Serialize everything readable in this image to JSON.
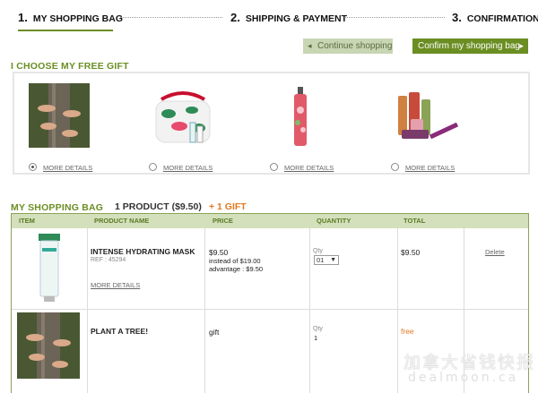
{
  "steps": [
    {
      "num": "1.",
      "label": "MY SHOPPING BAG"
    },
    {
      "num": "2.",
      "label": "SHIPPING & PAYMENT"
    },
    {
      "num": "3.",
      "label": "CONFIRMATION"
    }
  ],
  "actions": {
    "continue_label": "Continue shopping",
    "confirm_label": "Confirm my shopping bag"
  },
  "gift_section": {
    "title": "I CHOOSE MY FREE GIFT",
    "gifts": [
      {
        "image": "tree-hug-photo",
        "more": "MORE DETAILS",
        "selected": true
      },
      {
        "image": "floral-cosmetic-pouch",
        "more": "MORE DETAILS",
        "selected": false
      },
      {
        "image": "body-mist-spray",
        "more": "MORE DETAILS",
        "selected": false
      },
      {
        "image": "travel-size-products",
        "more": "MORE DETAILS",
        "selected": false
      }
    ]
  },
  "bag": {
    "title": "MY SHOPPING BAG",
    "count": "1 PRODUCT ($9.50)",
    "gift_count": "+ 1 GIFT",
    "headers": {
      "item": "ITEM",
      "name": "PRODUCT NAME",
      "price": "PRICE",
      "quantity": "QUANTITY",
      "total": "TOTAL"
    },
    "rows": [
      {
        "image": "hydrating-mask-tube",
        "name": "INTENSE HYDRATING MASK",
        "ref": "REF : 45294",
        "more": "MORE DETAILS",
        "price": "$9.50",
        "price_note": "instead of $19.00",
        "advantage": "advantage : $9.50",
        "qty_label": "Qty",
        "qty_value": "01",
        "total": "$9.50",
        "delete": "Delete"
      },
      {
        "image": "tree-hug-photo",
        "name": "PLANT A TREE!",
        "price": "gift",
        "qty_label": "Qty",
        "qty_value": "1",
        "total": "free"
      }
    ]
  },
  "watermark": {
    "line1": "加拿大省钱快报",
    "line2": "dealmoon.ca"
  },
  "colors": {
    "accent_green": "#6b8e23",
    "light_green": "#d4e0bc",
    "orange": "#e07a1f"
  }
}
